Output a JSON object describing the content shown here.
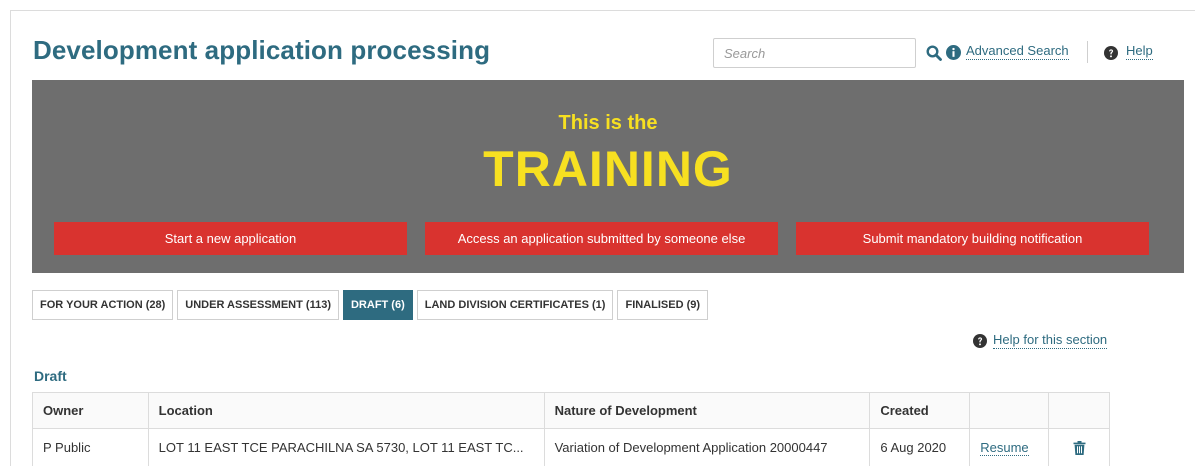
{
  "header": {
    "title": "Development application processing",
    "search_placeholder": "Search",
    "advanced_search": "Advanced Search",
    "help": "Help"
  },
  "banner": {
    "line1": "This is the",
    "line2": "TRAINING",
    "buttons": [
      "Start a new application",
      "Access an application submitted by someone else",
      "Submit mandatory building notification"
    ]
  },
  "tabs": [
    {
      "label": "FOR YOUR ACTION (28)",
      "active": false
    },
    {
      "label": "UNDER ASSESSMENT (113)",
      "active": false
    },
    {
      "label": "DRAFT (6)",
      "active": true
    },
    {
      "label": "LAND DIVISION CERTIFICATES (1)",
      "active": false
    },
    {
      "label": "FINALISED (9)",
      "active": false
    }
  ],
  "section": {
    "help_link": "Help for this section",
    "heading": "Draft"
  },
  "table": {
    "columns": [
      "Owner",
      "Location",
      "Nature of Development",
      "Created",
      "",
      ""
    ],
    "rows": [
      {
        "owner": "P Public",
        "location": "LOT 11 EAST TCE PARACHILNA SA 5730, LOT 11 EAST TC...",
        "nature": "Variation of Development Application 20000447",
        "created": "6 Aug 2020",
        "action": "Resume"
      }
    ]
  },
  "colors": {
    "brand_teal": "#2e6b80",
    "banner_grey": "#6e6e6e",
    "banner_text": "#f7e021",
    "button_red": "#d9332f"
  },
  "icons": {
    "search": "search-icon",
    "info": "info-icon",
    "help": "help-icon",
    "delete": "trash-icon"
  }
}
